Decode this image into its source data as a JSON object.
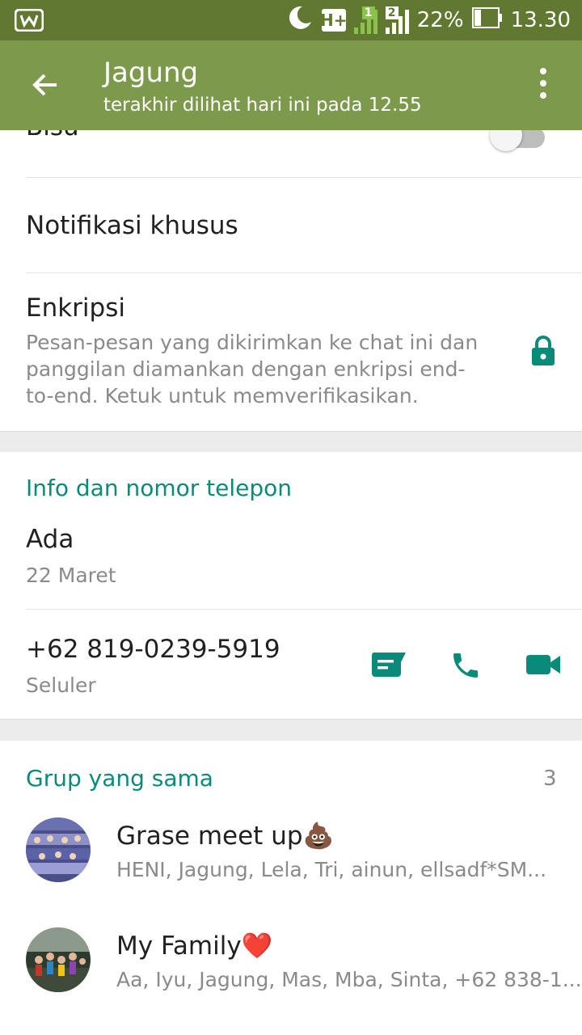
{
  "status_bar": {
    "app_icon": "w-icon",
    "network_type": "H+",
    "sim1": "1",
    "sim2": "2",
    "battery": "22%",
    "time": "13.30"
  },
  "app_bar": {
    "title": "Jagung",
    "subtitle": "terakhir dilihat hari ini pada 12.55"
  },
  "settings": {
    "mute_label": "Bisu",
    "custom_notifications_label": "Notifikasi khusus",
    "encryption_label": "Enkripsi",
    "encryption_text": "Pesan-pesan yang dikirimkan ke chat ini dan panggilan diamankan dengan enkripsi end-to-end. Ketuk untuk memverifikasikan."
  },
  "info": {
    "section_title": "Info dan nomor telepon",
    "about": "Ada",
    "about_date": "22 Maret",
    "phone": "+62 819-0239-5919",
    "phone_type": "Seluler"
  },
  "groups": {
    "section_title": "Grup yang sama",
    "count": "3",
    "items": [
      {
        "name": "Grase meet up",
        "emoji": "💩",
        "members": "HENI, Jagung, Lela, Tri, ainun, ellsadf*SM..."
      },
      {
        "name": "My Family",
        "emoji": "❤️",
        "members": "Aa, Iyu, Jagung, Mas, Mba, Sinta, +62 838-1..."
      }
    ]
  },
  "colors": {
    "status_bar": "#60782f",
    "app_bar": "#7d9a4c",
    "accent": "#0a8b7a"
  }
}
